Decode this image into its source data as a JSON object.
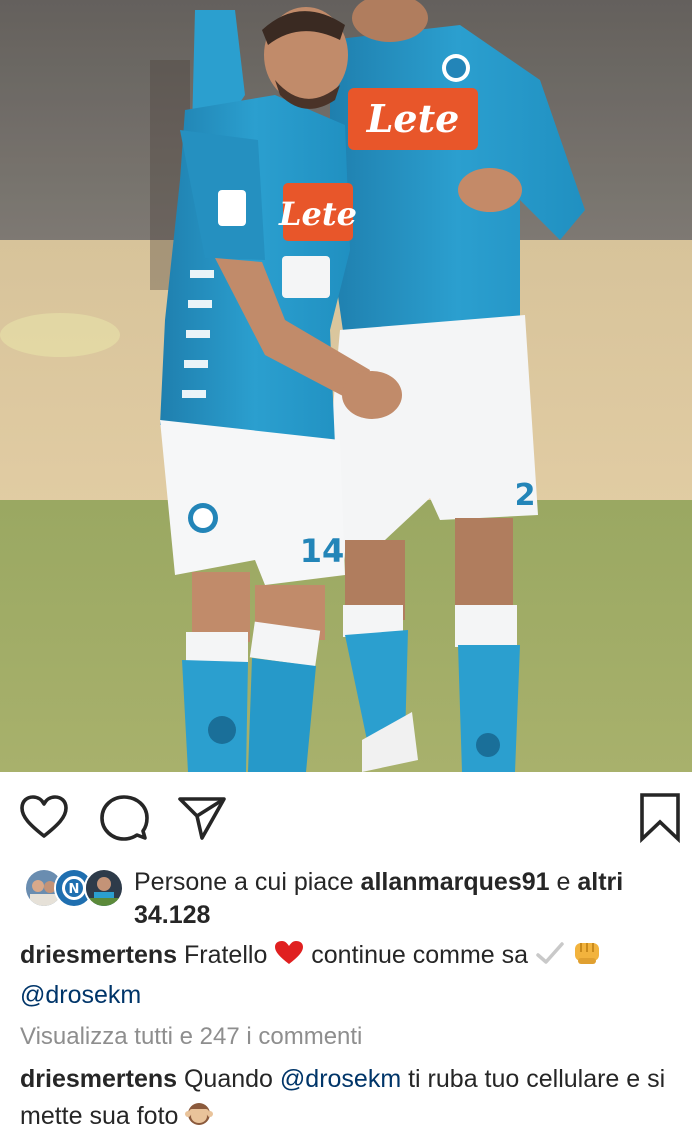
{
  "post": {
    "photo_icon": "two-footballers-image",
    "jersey_sponsor": "Lete",
    "jersey_number_left": "14",
    "jersey_number_right": "2"
  },
  "actions": {
    "like_icon": "heart-icon",
    "comment_icon": "comment-icon",
    "share_icon": "paper-plane-icon",
    "save_icon": "bookmark-icon"
  },
  "likes": {
    "prefix": "Persone a cui piace",
    "user": "allanmarques91",
    "connector": "e",
    "others_label": "altri",
    "others_count": "34.128"
  },
  "caption": {
    "username": "driesmertens",
    "text_before": "Fratello",
    "heart_icon": "red-heart-emoji",
    "text_after": "continue comme sa",
    "check_icon": "check-mark-emoji",
    "fist_icon": "fist-emoji",
    "mention": "@drosekm"
  },
  "view_all_comments": "Visualizza tutti e 247 i commenti",
  "comment": {
    "username": "driesmertens",
    "text_before": "Quando",
    "mention": "@drosekm",
    "text_after": "ti ruba tuo cellulare e si mette sua foto",
    "monkey_icon": "see-no-evil-monkey-emoji"
  },
  "colors": {
    "text": "#262626",
    "secondary_text": "#8e8e8e",
    "mention": "#003569",
    "heart_red": "#ed4956",
    "napoli_blue": "#2aa3d1"
  }
}
